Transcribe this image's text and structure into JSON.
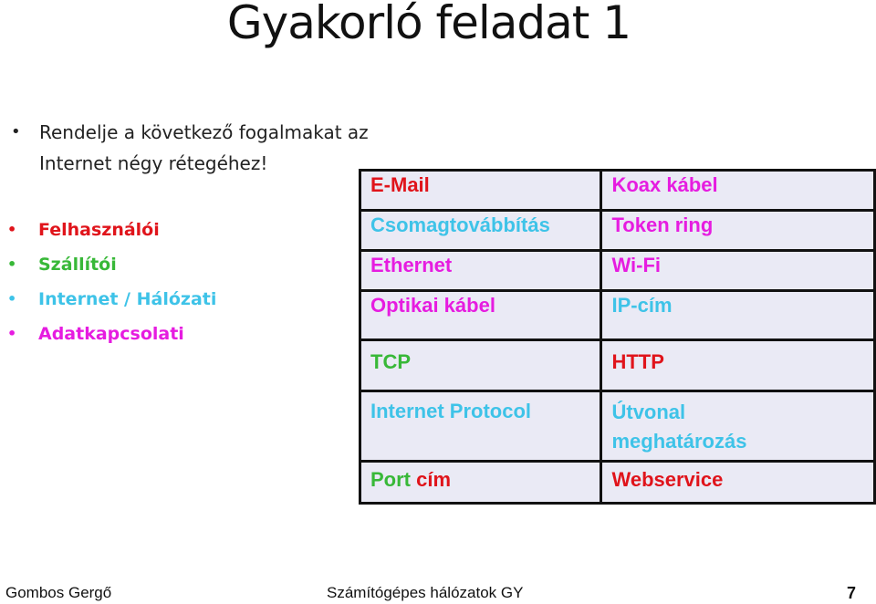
{
  "slide": {
    "title": "Gyakorló feladat 1",
    "instruction": "Rendelje a következő fogalmakat az Internet négy rétegéhez!",
    "layers": [
      {
        "label": "Felhasználói",
        "color": "#e0141b"
      },
      {
        "label": "Szállítói",
        "color": "#38b838"
      },
      {
        "label": "Internet / Hálózati",
        "color": "#3ec3e8"
      },
      {
        "label": "Adatkapcsolati",
        "color": "#e61ce0"
      }
    ],
    "table": {
      "rows": [
        {
          "left": "E-Mail",
          "right": "Koax kábel"
        },
        {
          "left": "Csomagtovábbítás",
          "right": "Token ring"
        },
        {
          "left": "Ethernet",
          "right": "Wi-Fi"
        },
        {
          "left": "Optikai kábel",
          "right": "IP-cím"
        },
        {
          "left": "TCP",
          "right": "HTTP"
        },
        {
          "left": "Internet Protocol",
          "right_line1": "Útvonal",
          "right_line2": "meghatározás"
        },
        {
          "left_part1": "Port",
          "left_part2": "cím",
          "right": "Webservice"
        }
      ]
    },
    "footer": {
      "author": "Gombos Gergő",
      "course": "Számítógépes hálózatok GY",
      "page": "7"
    }
  }
}
